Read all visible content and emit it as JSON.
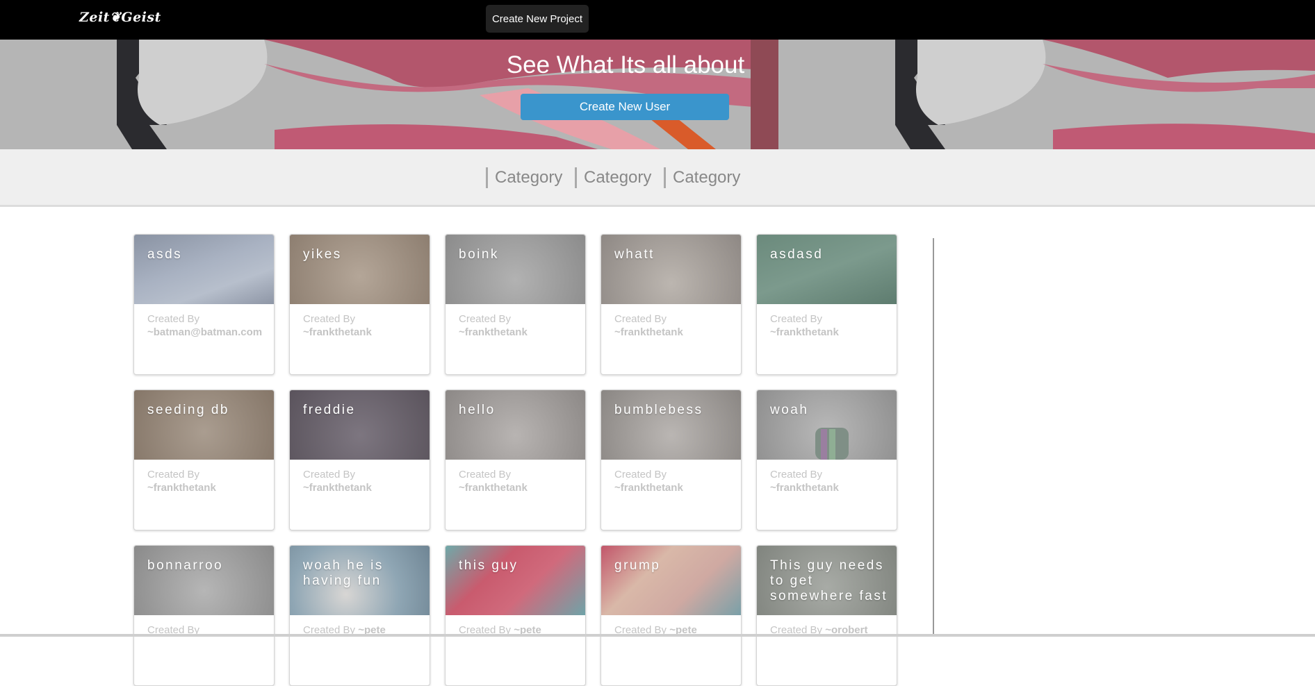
{
  "nav": {
    "logo": "Zeit❦Geist",
    "create_project_label": "Create New Project"
  },
  "hero": {
    "title": "See What Its all about",
    "create_user_label": "Create New User"
  },
  "categories": [
    "Category",
    "Category",
    "Category"
  ],
  "cards": [
    {
      "title": "asds",
      "created_label": "Created By",
      "author": "~batman@batman.com"
    },
    {
      "title": "yikes",
      "created_label": "Created By",
      "author": "~frankthetank"
    },
    {
      "title": "boink",
      "created_label": "Created By",
      "author": "~frankthetank"
    },
    {
      "title": "whatt",
      "created_label": "Created By",
      "author": "~frankthetank"
    },
    {
      "title": "asdasd",
      "created_label": "Created By",
      "author": "~frankthetank"
    },
    {
      "title": "seeding db",
      "created_label": "Created By",
      "author": "~frankthetank"
    },
    {
      "title": "freddie",
      "created_label": "Created By",
      "author": "~frankthetank"
    },
    {
      "title": "hello",
      "created_label": "Created By",
      "author": "~frankthetank"
    },
    {
      "title": "bumblebess",
      "created_label": "Created By",
      "author": "~frankthetank"
    },
    {
      "title": "woah",
      "created_label": "Created By",
      "author": "~frankthetank"
    },
    {
      "title": "bonnarroo",
      "created_label": "Created By",
      "author": ""
    },
    {
      "title": "woah he is having fun",
      "created_label": "Created By",
      "author": "~pete"
    },
    {
      "title": "this guy",
      "created_label": "Created By",
      "author": "~pete"
    },
    {
      "title": "grump",
      "created_label": "Created By",
      "author": "~pete"
    },
    {
      "title": "This guy needs to get somewhere fast",
      "created_label": "Created By",
      "author": "~orobert"
    }
  ]
}
